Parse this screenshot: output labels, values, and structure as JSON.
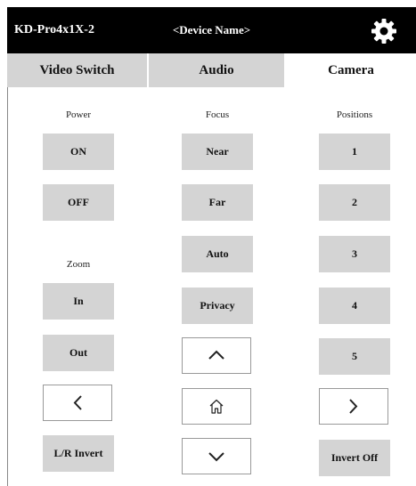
{
  "header": {
    "device_id": "KD-Pro4x1X-2",
    "device_name": "<Device Name>",
    "settings_icon": "gear-icon"
  },
  "tabs": [
    {
      "label": "Video Switch",
      "active": false
    },
    {
      "label": "Audio",
      "active": false
    },
    {
      "label": "Camera",
      "active": true
    }
  ],
  "power": {
    "label": "Power",
    "on": "ON",
    "off": "OFF"
  },
  "zoom": {
    "label": "Zoom",
    "in": "In",
    "out": "Out",
    "left_icon": "chevron-left-icon",
    "lr_invert": "L/R Invert"
  },
  "focus": {
    "label": "Focus",
    "near": "Near",
    "far": "Far",
    "auto": "Auto",
    "privacy": "Privacy",
    "up_icon": "chevron-up-icon",
    "home_icon": "home-icon",
    "down_icon": "chevron-down-icon"
  },
  "positions": {
    "label": "Positions",
    "items": [
      "1",
      "2",
      "3",
      "4",
      "5"
    ],
    "right_icon": "chevron-right-icon",
    "invert": "Invert Off"
  },
  "colors": {
    "header_bg": "#000000",
    "button_bg": "#d4d4d4",
    "tab_inactive_bg": "#d4d4d4"
  }
}
